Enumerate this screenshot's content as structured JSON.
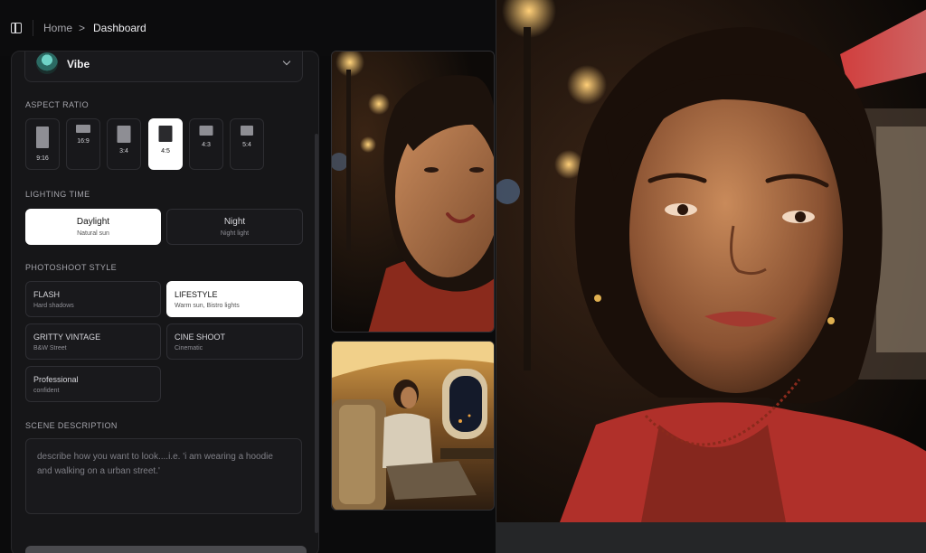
{
  "breadcrumb": {
    "home": "Home",
    "separator": ">",
    "current": "Dashboard"
  },
  "model": {
    "name": "Vibe"
  },
  "aspect_ratio": {
    "label": "ASPECT RATIO",
    "selected": "4:5",
    "options": [
      {
        "label": "9:16"
      },
      {
        "label": "16:9"
      },
      {
        "label": "3:4"
      },
      {
        "label": "4:5"
      },
      {
        "label": "4:3"
      },
      {
        "label": "5:4"
      }
    ]
  },
  "lighting": {
    "label": "LIGHTING TIME",
    "selected": "Daylight",
    "options": [
      {
        "title": "Daylight",
        "sub": "Natural sun"
      },
      {
        "title": "Night",
        "sub": "Night light"
      }
    ]
  },
  "style": {
    "label": "PHOTOSHOOT STYLE",
    "selected": "LIFESTYLE",
    "options": [
      {
        "title": "FLASH",
        "sub": "Hard shadows"
      },
      {
        "title": "LIFESTYLE",
        "sub": "Warm sun, Bistro lights"
      },
      {
        "title": "GRITTY VINTAGE",
        "sub": "B&W Street"
      },
      {
        "title": "CINE SHOOT",
        "sub": "Cinematic"
      },
      {
        "title": "Professional",
        "sub": "confident"
      }
    ]
  },
  "scene": {
    "label": "SCENE DESCRIPTION",
    "placeholder": "describe how you want to look....i.e. 'i am wearing a hoodie and walking on a urban street.'"
  },
  "colors": {
    "accent_selected": "#ffffff",
    "panel_bg": "#161618",
    "app_bg": "#0b0b0c"
  }
}
